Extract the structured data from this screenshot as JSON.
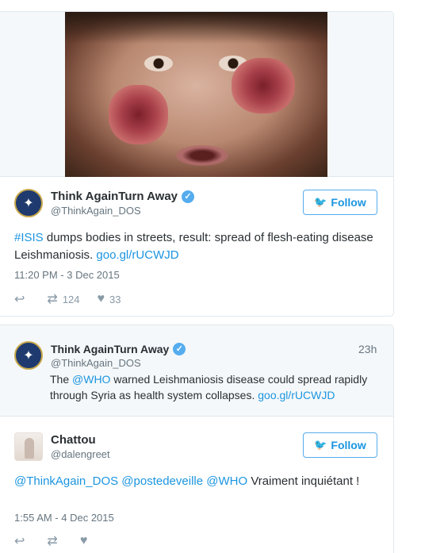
{
  "tweet1": {
    "display_name": "Think AgainTurn Away",
    "handle": "@ThinkAgain_DOS",
    "follow_label": "Follow",
    "text_hashtag": "#ISIS",
    "text_body": " dumps bodies in streets, result: spread of flesh-eating disease Leishmaniosis. ",
    "text_link": "goo.gl/rUCWJD",
    "timestamp": "11:20 PM - 3 Dec 2015",
    "retweets": "124",
    "likes": "33"
  },
  "quoted": {
    "display_name": "Think AgainTurn Away",
    "handle": "@ThinkAgain_DOS",
    "time_ago": "23h",
    "text_pre": "The ",
    "text_mention": "@WHO",
    "text_body": " warned Leishmaniosis disease could spread rapidly through Syria as health system collapses. ",
    "text_link": "goo.gl/rUCWJD"
  },
  "tweet2": {
    "display_name": "Chattou",
    "handle": "@dalengreet",
    "follow_label": "Follow",
    "mention1": "@ThinkAgain_DOS",
    "mention2": "@postedeveille",
    "mention3": "@WHO",
    "text_body": " Vraiment inquiétant !",
    "timestamp": "1:55 AM - 4 Dec 2015"
  },
  "icons": {
    "verified": "verified-badge-icon",
    "bird": "twitter-bird-icon",
    "reply": "reply-icon",
    "retweet": "retweet-icon",
    "like": "heart-icon"
  },
  "colors": {
    "link": "#1b95e0",
    "verified": "#55acee",
    "muted": "#66757f"
  }
}
